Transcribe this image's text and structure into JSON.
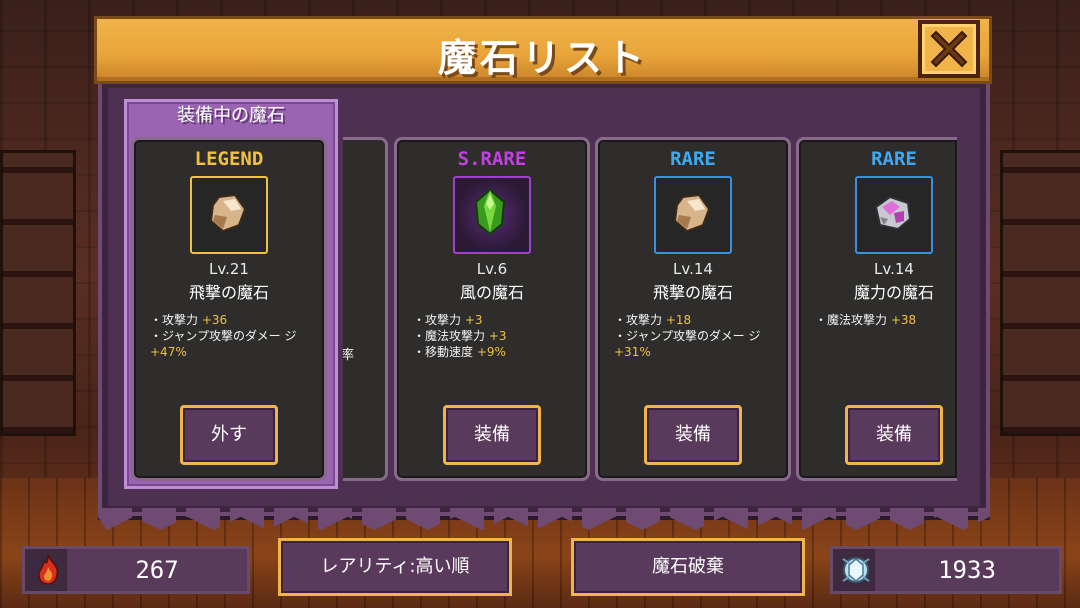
{
  "title": "魔石リスト",
  "equipped_section_label": "装備中の魔石",
  "partial_card_text": "率",
  "colors": {
    "legend": "#f0c040",
    "s_rare": "#c040e0",
    "rare": "#40a8f0",
    "bonus": "#f0c040",
    "accent": "#f0b44a"
  },
  "cards": [
    {
      "rarity": "LEGEND",
      "rarity_color": "#f0c040",
      "level": "Lv.21",
      "name": "飛撃の魔石",
      "gem_icon": "rock-gem-icon",
      "stats": [
        {
          "label": "・攻撃力",
          "bonus": "+36"
        },
        {
          "label": "・ジャンプ攻撃のダメー ジ",
          "bonus": "+47%"
        }
      ],
      "button": "外す"
    },
    {
      "rarity": "S.RARE",
      "rarity_color": "#c040e0",
      "level": "Lv.6",
      "name": "風の魔石",
      "gem_icon": "green-crystal-icon",
      "stats": [
        {
          "label": "・攻撃力",
          "bonus": "+3"
        },
        {
          "label": "・魔法攻撃力",
          "bonus": "+3"
        },
        {
          "label": "・移動速度",
          "bonus": "+9%"
        }
      ],
      "button": "装備"
    },
    {
      "rarity": "RARE",
      "rarity_color": "#40a8f0",
      "level": "Lv.14",
      "name": "飛撃の魔石",
      "gem_icon": "rock-gem-icon",
      "stats": [
        {
          "label": "・攻撃力",
          "bonus": "+18"
        },
        {
          "label": "・ジャンプ攻撃のダメー ジ",
          "bonus": "+31%"
        }
      ],
      "button": "装備"
    },
    {
      "rarity": "RARE",
      "rarity_color": "#40a8f0",
      "level": "Lv.14",
      "name": "魔力の魔石",
      "gem_icon": "pink-stone-icon",
      "stats": [
        {
          "label": "・魔法攻撃力",
          "bonus": "+38"
        }
      ],
      "button": "装備"
    }
  ],
  "bottom": {
    "left_count": "267",
    "sort_button": "レアリティ:高い順",
    "destroy_button": "魔石破棄",
    "right_count": "1933"
  }
}
